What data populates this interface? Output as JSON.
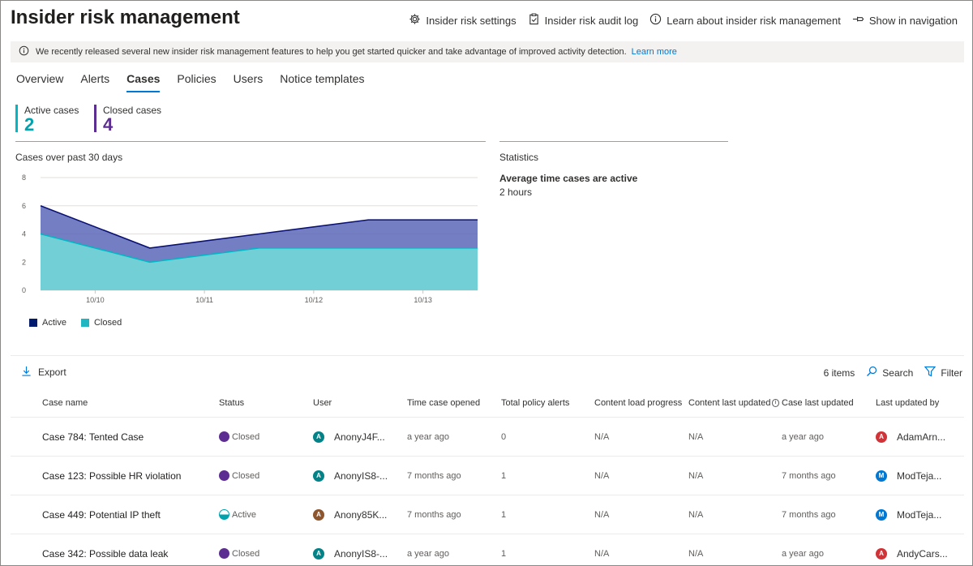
{
  "header": {
    "title": "Insider risk management",
    "actions": [
      {
        "label": "Insider risk settings",
        "icon": "gear-icon"
      },
      {
        "label": "Insider risk audit log",
        "icon": "clipboard-icon"
      },
      {
        "label": "Learn about insider risk management",
        "icon": "info-icon"
      },
      {
        "label": "Show in navigation",
        "icon": "pin-icon"
      }
    ]
  },
  "banner": {
    "text": "We recently released several new insider risk management features to help you get started quicker and take advantage of improved activity detection.",
    "link": "Learn more"
  },
  "tabs": [
    {
      "label": "Overview",
      "active": false
    },
    {
      "label": "Alerts",
      "active": false
    },
    {
      "label": "Cases",
      "active": true
    },
    {
      "label": "Policies",
      "active": false
    },
    {
      "label": "Users",
      "active": false
    },
    {
      "label": "Notice templates",
      "active": false
    }
  ],
  "kpis": {
    "active": {
      "label": "Active cases",
      "value": "2"
    },
    "closed": {
      "label": "Closed cases",
      "value": "4"
    }
  },
  "chart_data": {
    "type": "area",
    "title": "Cases over past 30 days",
    "xlabel": "",
    "ylabel": "",
    "ylim": [
      0,
      8
    ],
    "yticks": [
      "0",
      "2",
      "4",
      "6",
      "8"
    ],
    "x_tick_labels": [
      "10/10",
      "10/11",
      "10/12",
      "10/13"
    ],
    "x": [
      0,
      1,
      2,
      3,
      4
    ],
    "stacked": true,
    "grid": true,
    "legend": "bottom-left",
    "series": [
      {
        "name": "Closed",
        "color": "#00b7c3",
        "values": [
          4,
          2,
          3,
          3,
          3
        ]
      },
      {
        "name": "Active",
        "color": "#5c67b8",
        "line_color": "#0a1172",
        "values": [
          2,
          1,
          1,
          2,
          2
        ]
      }
    ],
    "legend_entries": [
      {
        "name": "Active",
        "color": "#001a6e"
      },
      {
        "name": "Closed",
        "color": "#1db6c1"
      }
    ]
  },
  "statistics": {
    "title": "Statistics",
    "metric_label": "Average time cases are active",
    "metric_value": "2 hours"
  },
  "commands": {
    "export": "Export",
    "items_count": "6 items",
    "search": "Search",
    "filter": "Filter"
  },
  "table": {
    "headers": {
      "name": "Case name",
      "status": "Status",
      "user": "User",
      "time": "Time case opened",
      "alerts": "Total policy alerts",
      "load": "Content load progress",
      "cupd": "Content last updated",
      "last": "Case last updated",
      "by": "Last updated by"
    },
    "rows": [
      {
        "name": "Case 784: Tented Case",
        "status": "Closed",
        "user_initial": "A",
        "user_color": "#038387",
        "user": "AnonyJ4F...",
        "time": "a year ago",
        "alerts": "0",
        "load": "N/A",
        "cupd": "N/A",
        "last": "a year ago",
        "by_initial": "A",
        "by_color": "#d13438",
        "by": "AdamArn..."
      },
      {
        "name": "Case 123: Possible HR violation",
        "status": "Closed",
        "user_initial": "A",
        "user_color": "#038387",
        "user": "AnonyIS8-...",
        "time": "7 months ago",
        "alerts": "1",
        "load": "N/A",
        "cupd": "N/A",
        "last": "7 months ago",
        "by_initial": "M",
        "by_color": "#0078d4",
        "by": "ModTeja..."
      },
      {
        "name": "Case 449: Potential IP theft",
        "status": "Active",
        "user_initial": "A",
        "user_color": "#8e562e",
        "user": "Anony85K...",
        "time": "7 months ago",
        "alerts": "1",
        "load": "N/A",
        "cupd": "N/A",
        "last": "7 months ago",
        "by_initial": "M",
        "by_color": "#0078d4",
        "by": "ModTeja..."
      },
      {
        "name": "Case 342: Possible data leak",
        "status": "Closed",
        "user_initial": "A",
        "user_color": "#038387",
        "user": "AnonyIS8-...",
        "time": "a year ago",
        "alerts": "1",
        "load": "N/A",
        "cupd": "N/A",
        "last": "a year ago",
        "by_initial": "A",
        "by_color": "#d13438",
        "by": "AndyCars..."
      }
    ]
  }
}
